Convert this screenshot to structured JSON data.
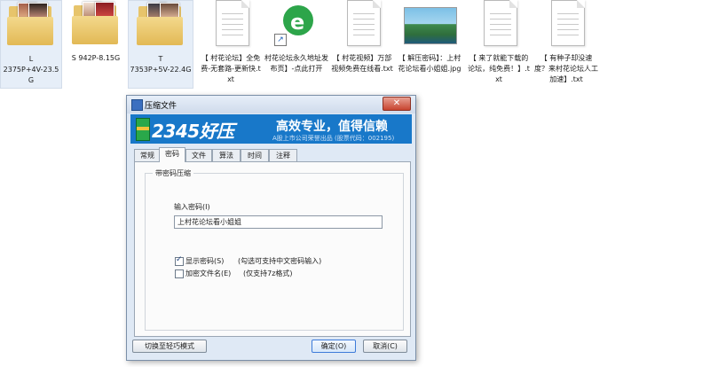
{
  "files": [
    {
      "kind": "folder",
      "name": "L\n2375P+4V-23.5G",
      "selected": true
    },
    {
      "kind": "folder",
      "name": "S  942P-8.15G",
      "selected": false
    },
    {
      "kind": "folder",
      "name": "T\n7353P+5V-22.4G",
      "selected": true
    },
    {
      "kind": "text",
      "name": "【 村花论坛】全免费-无套路-更新快.txt"
    },
    {
      "kind": "shortcut",
      "name": "村花论坛永久地址发布页】-点此打开"
    },
    {
      "kind": "text",
      "name": "【 村花视频】万部视频免费在线看.txt"
    },
    {
      "kind": "image",
      "name": "【 解压密码】：上村花论坛看小姐姐.jpg"
    },
    {
      "kind": "text",
      "name": "【 来了就能下载的论坛，纯免费！】.txt"
    },
    {
      "kind": "text",
      "name": "【 有种子却没速度？来村花论坛人工加速】.txt"
    }
  ],
  "dialog": {
    "title": "压缩文件",
    "close_label": "✕",
    "banner": {
      "logo": "2345好压",
      "slogan": "高效专业，值得信赖",
      "sub": "A股上市公司荣誉出品 (股票代码：002195)"
    },
    "tabs": [
      "常规",
      "密码",
      "文件",
      "算法",
      "时间",
      "注释"
    ],
    "active_tab": "密码",
    "group_title": "带密码压缩",
    "password_label": "输入密码(I)",
    "password_value": "上村花论坛看小姐姐",
    "show_password_label": "显示密码(S)",
    "show_password_hint": "(勾选可支持中文密码输入)",
    "show_password_checked": true,
    "encrypt_names_label": "加密文件名(E)",
    "encrypt_names_hint": "(仅支持7z格式)",
    "encrypt_names_checked": false,
    "switch_mode_label": "切换至轻巧模式",
    "ok_label": "确定(O)",
    "cancel_label": "取消(C)"
  }
}
